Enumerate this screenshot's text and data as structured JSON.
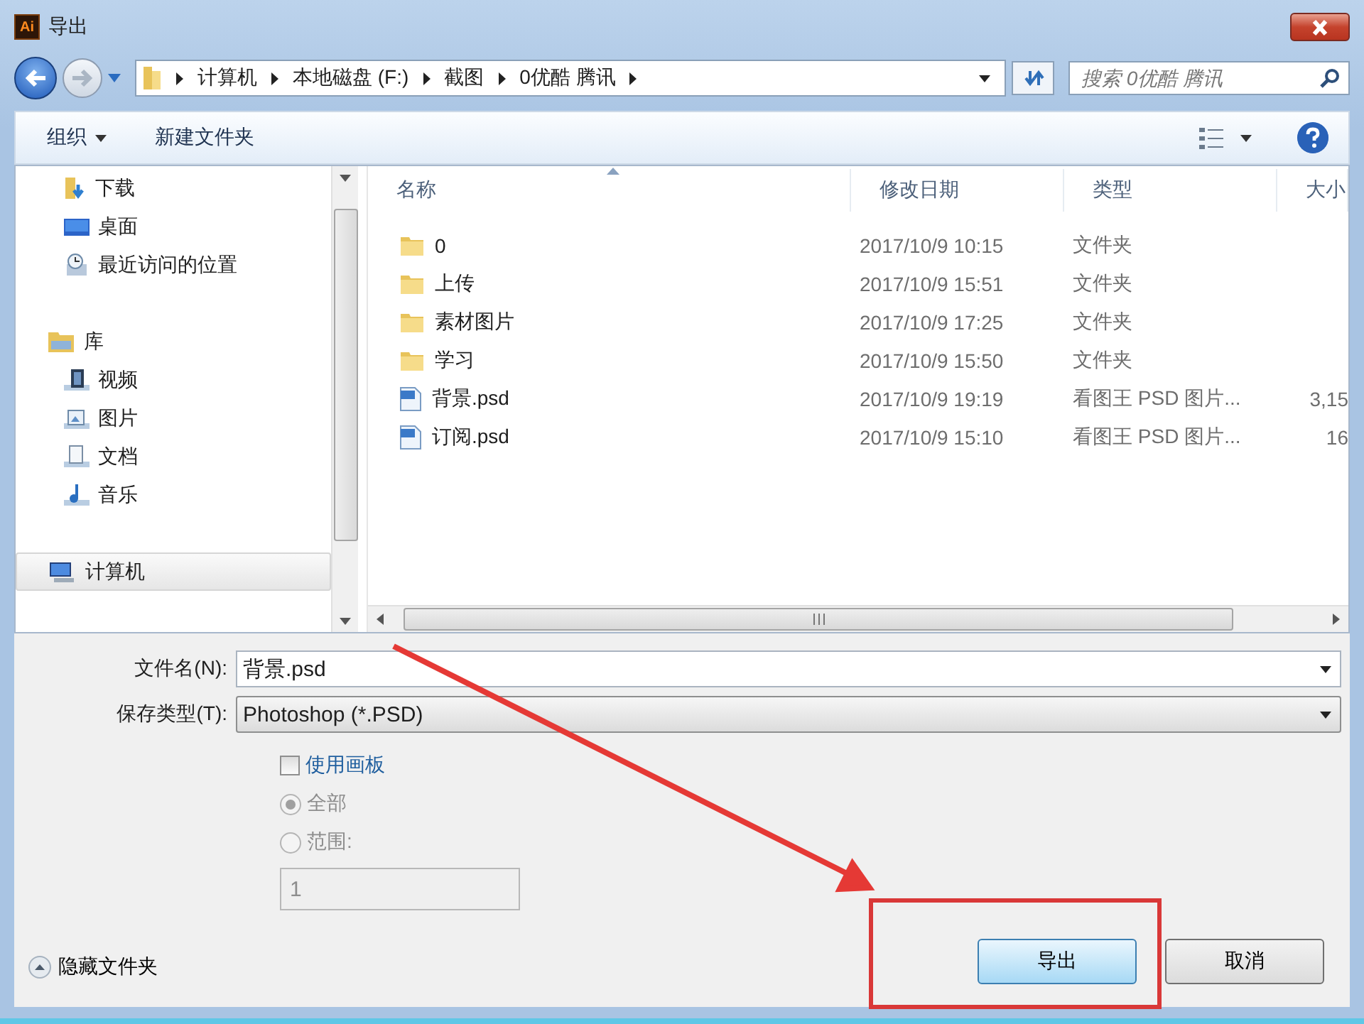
{
  "window": {
    "app_icon": "Ai",
    "title": "导出"
  },
  "address_bar": {
    "breadcrumb": [
      "计算机",
      "本地磁盘 (F:)",
      "截图",
      "0优酷 腾讯"
    ]
  },
  "search": {
    "placeholder": "搜索 0优酷 腾讯"
  },
  "toolbar": {
    "organize": "组织",
    "new_folder": "新建文件夹"
  },
  "nav_pane": {
    "favorites": [
      {
        "label": "下载",
        "kind": "downloads",
        "selected": false
      },
      {
        "label": "桌面",
        "kind": "desktop",
        "selected": false
      },
      {
        "label": "最近访问的位置",
        "kind": "recent",
        "selected": false
      }
    ],
    "tree": [
      {
        "label": "库",
        "kind": "library",
        "selected": false,
        "children": [
          {
            "label": "视频",
            "kind": "videos",
            "selected": false
          },
          {
            "label": "图片",
            "kind": "pictures",
            "selected": false
          },
          {
            "label": "文档",
            "kind": "documents",
            "selected": false
          },
          {
            "label": "音乐",
            "kind": "music",
            "selected": false
          }
        ]
      },
      {
        "label": "计算机",
        "kind": "computer",
        "selected": true
      }
    ]
  },
  "file_list": {
    "columns": [
      "名称",
      "修改日期",
      "类型",
      "大小"
    ],
    "rows": [
      {
        "kind": "folder",
        "name": "0",
        "modified": "2017/10/9 10:15",
        "type": "文件夹"
      },
      {
        "kind": "folder",
        "name": "上传",
        "modified": "2017/10/9 15:51",
        "type": "文件夹"
      },
      {
        "kind": "folder",
        "name": "素材图片",
        "modified": "2017/10/9 17:25",
        "type": "文件夹"
      },
      {
        "kind": "folder",
        "name": "学习",
        "modified": "2017/10/9 15:50",
        "type": "文件夹"
      },
      {
        "kind": "psd",
        "name": "背景.psd",
        "modified": "2017/10/9 19:19",
        "type": "看图王 PSD 图片...",
        "size": "3,15"
      },
      {
        "kind": "psd",
        "name": "订阅.psd",
        "modified": "2017/10/9 15:10",
        "type": "看图王 PSD 图片...",
        "size": "16"
      }
    ]
  },
  "form": {
    "file_name": {
      "label": "文件名(N):",
      "value": "背景.psd"
    },
    "save_type": {
      "label": "保存类型(T):",
      "value": "Photoshop (*.PSD)"
    },
    "use_artboards": {
      "label": "使用画板",
      "checked": false
    },
    "range_options": [
      {
        "label": "全部",
        "selected": true,
        "disabled": true
      },
      {
        "label": "范围:",
        "selected": false,
        "disabled": true
      }
    ],
    "range_field": {
      "value": "1",
      "disabled": true
    }
  },
  "hide_folders": "隐藏文件夹",
  "buttons": [
    {
      "label": "导出",
      "default": true
    },
    {
      "label": "取消",
      "default": false
    }
  ]
}
